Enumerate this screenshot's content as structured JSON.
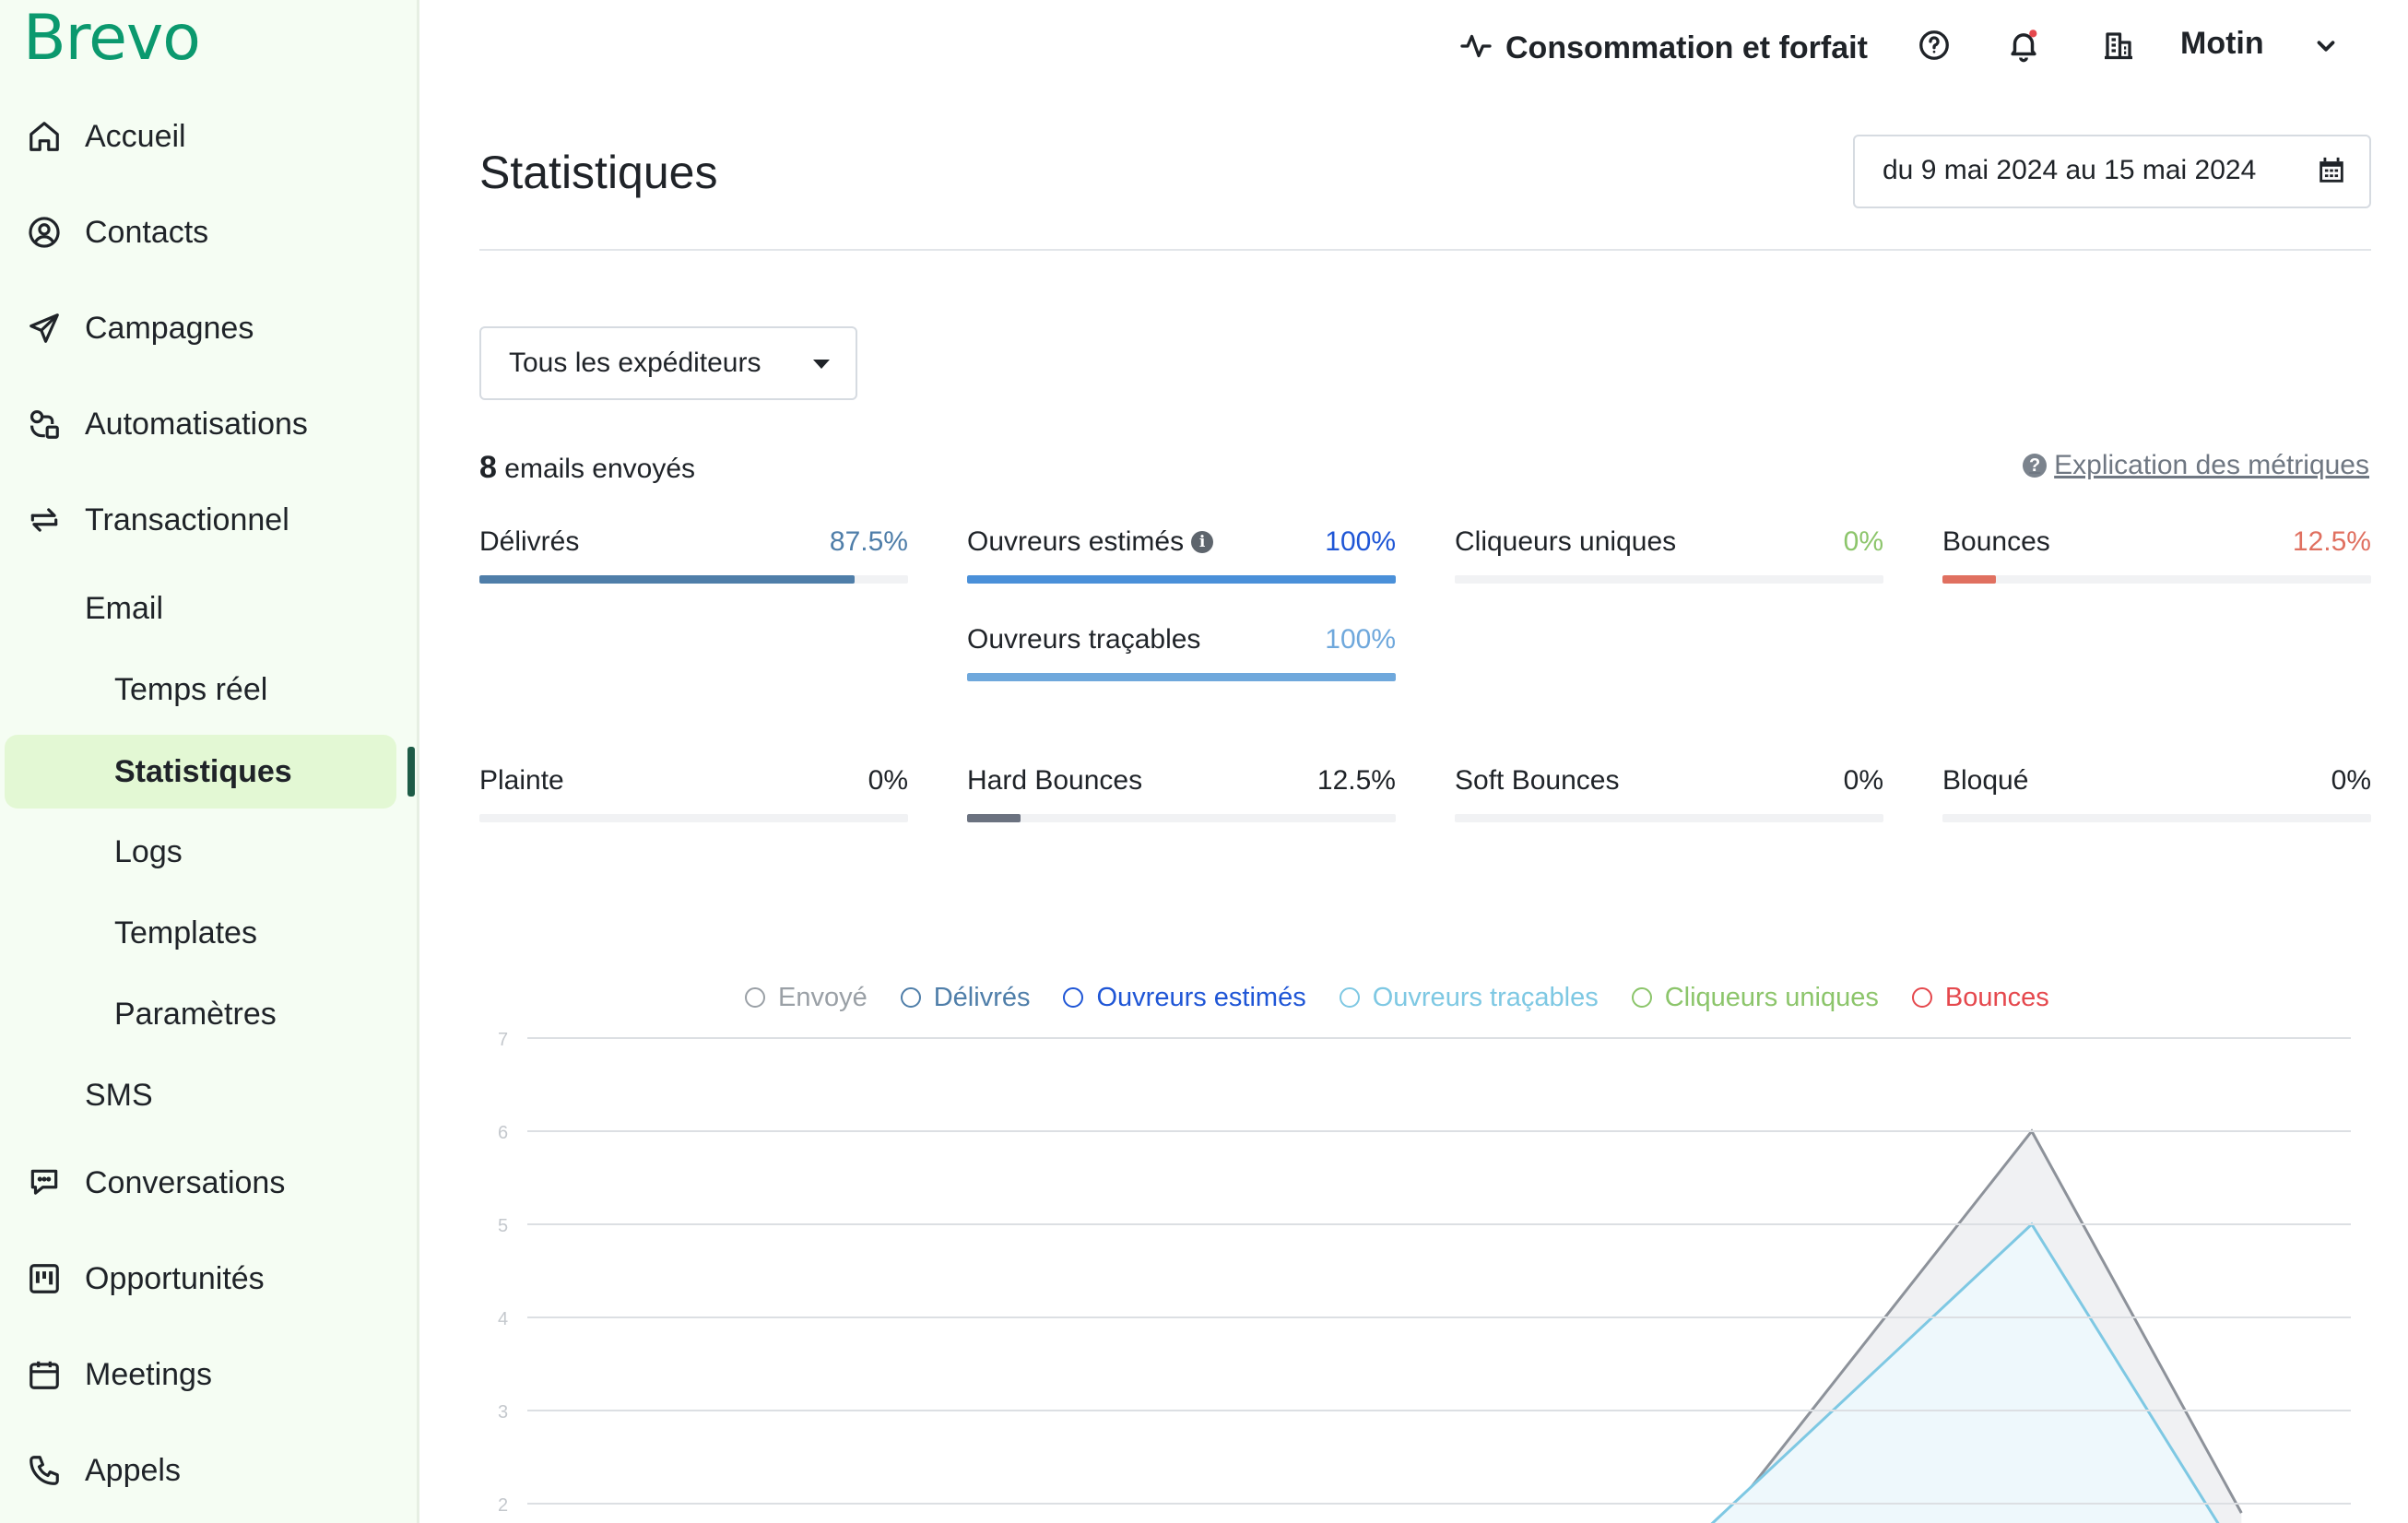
{
  "sidebar": {
    "logo": "Brevo",
    "nav": [
      {
        "label": "Accueil",
        "icon": "home-icon"
      },
      {
        "label": "Contacts",
        "icon": "contact-icon"
      },
      {
        "label": "Campagnes",
        "icon": "send-icon"
      },
      {
        "label": "Automatisations",
        "icon": "automation-icon"
      },
      {
        "label": "Transactionnel",
        "icon": "transactional-icon"
      }
    ],
    "email_label": "Email",
    "email_sub": [
      "Temps réel",
      "Statistiques",
      "Logs",
      "Templates",
      "Paramètres"
    ],
    "sms_label": "SMS",
    "nav_bottom": [
      {
        "label": "Conversations",
        "icon": "chat-icon"
      },
      {
        "label": "Opportunités",
        "icon": "kanban-icon"
      },
      {
        "label": "Meetings",
        "icon": "calendar-icon"
      },
      {
        "label": "Appels",
        "icon": "phone-icon"
      }
    ],
    "active_item": "Statistiques"
  },
  "header": {
    "consumption_label": "Consommation et forfait",
    "user_name": "Motin",
    "notification_dot_color": "#e5484d"
  },
  "main": {
    "title": "Statistiques",
    "date_range": "du 9 mai 2024 au 15 mai 2024",
    "sender_select": "Tous les expéditeurs",
    "emails_sent_count": "8",
    "emails_sent_label": "emails envoyés",
    "explain_link": " Explication des métriques",
    "metrics": [
      {
        "name": "Délivrés",
        "value": "87.5%",
        "pct": 87.5,
        "color": "#4f7ea9",
        "val_color": "#4f7ea9"
      },
      {
        "name": "Ouvreurs estimés",
        "value": "100%",
        "pct": 100,
        "color": "#4a90d9",
        "val_color": "#1f56d6"
      },
      {
        "name": "Cliqueurs uniques",
        "value": "0%",
        "pct": 0,
        "color": "#8cc56b",
        "val_color": "#8cc56b"
      },
      {
        "name": "Bounces",
        "value": "12.5%",
        "pct": 12.5,
        "color": "#e07060",
        "val_color": "#e07060"
      },
      {
        "name": "Ouvreurs traçables",
        "value": "100%",
        "pct": 100,
        "color": "#6fa8dc",
        "val_color": "#6fa8dc"
      },
      {
        "name": "Plainte",
        "value": "0%",
        "pct": 0,
        "color": "#6b7280",
        "val_color": "#1f2328"
      },
      {
        "name": "Hard Bounces",
        "value": "12.5%",
        "pct": 12.5,
        "color": "#6b7280",
        "val_color": "#1f2328"
      },
      {
        "name": "Soft Bounces",
        "value": "0%",
        "pct": 0,
        "color": "#6b7280",
        "val_color": "#1f2328"
      },
      {
        "name": "Bloqué",
        "value": "0%",
        "pct": 0,
        "color": "#6b7280",
        "val_color": "#1f2328"
      }
    ]
  },
  "chart_data": {
    "type": "area",
    "legend": [
      {
        "name": "Envoyé",
        "color": "#9aa0a6"
      },
      {
        "name": "Délivrés",
        "color": "#4f7ea9"
      },
      {
        "name": "Ouvreurs estimés",
        "color": "#1f56d6"
      },
      {
        "name": "Ouvreurs traçables",
        "color": "#7ec8e3"
      },
      {
        "name": "Cliqueurs uniques",
        "color": "#8cc56b"
      },
      {
        "name": "Bounces",
        "color": "#e5484d"
      }
    ],
    "y_ticks": [
      "7",
      "6",
      "5",
      "4",
      "3",
      "2"
    ],
    "ylim": [
      2,
      7
    ],
    "grid": true,
    "series": [
      {
        "name": "Envoyé",
        "color": "#8d929a",
        "fill": "#f0f1f3",
        "points": [
          [
            0.66,
            1.9
          ],
          [
            0.825,
            6
          ],
          [
            0.94,
            1.9
          ]
        ]
      },
      {
        "name": "Ouvreurs traçables",
        "color": "#7ec8e3",
        "fill": "#eef8fc",
        "points": [
          [
            0.645,
            1.7
          ],
          [
            0.825,
            5
          ],
          [
            0.93,
            1.7
          ]
        ]
      }
    ]
  }
}
